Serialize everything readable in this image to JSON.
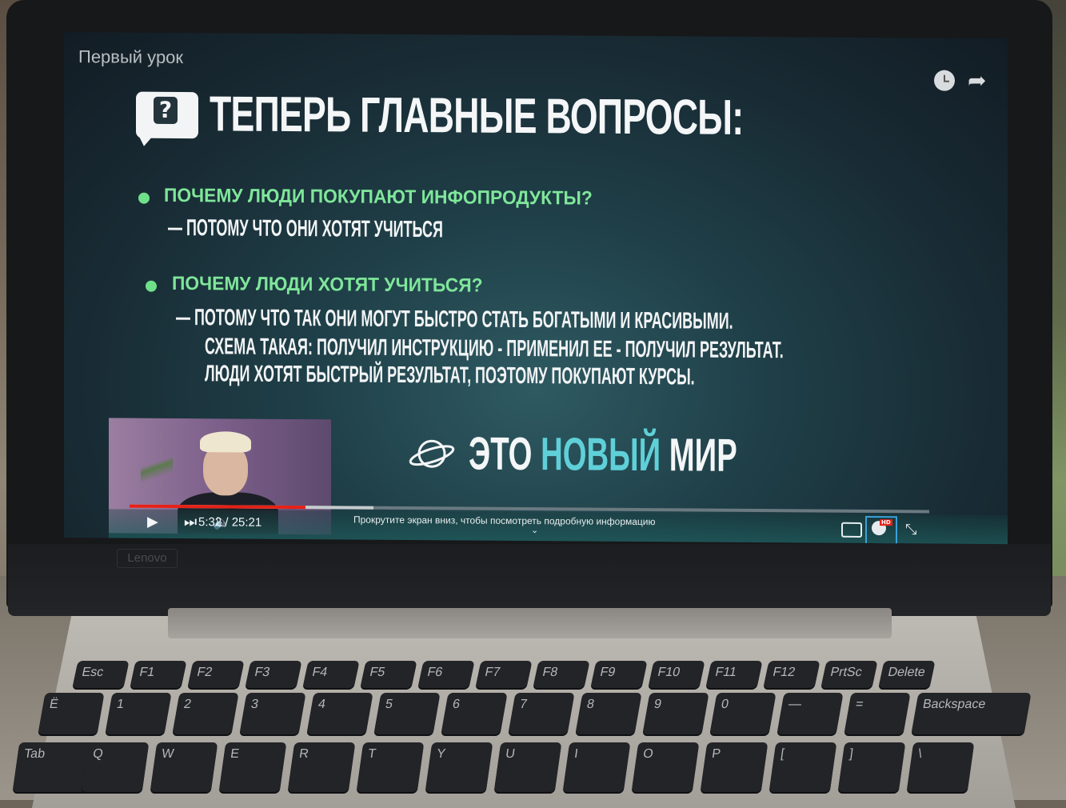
{
  "player": {
    "video_title": "Первый урок",
    "current_time": "5:32",
    "total_time": "25:21",
    "time_display": "5:32 / 25:21",
    "progress_fraction": 0.22,
    "buffer_fraction": 0.305,
    "scroll_hint": "Прокрутите экран вниз, чтобы посмотреть подробную информацию",
    "hd_badge": "HD",
    "icons": [
      "play-icon",
      "next-icon",
      "volume-icon",
      "captions-icon",
      "settings-icon",
      "exit-fullscreen-icon",
      "watch-later-icon",
      "share-icon"
    ]
  },
  "slide": {
    "title": "ТЕПЕРЬ ГЛАВНЫЕ ВОПРОСЫ:",
    "q1": "ПОЧЕМУ ЛЮДИ ПОКУПАЮТ ИНФОПРОДУКТЫ?",
    "a1": "— ПОТОМУ ЧТО ОНИ ХОТЯТ УЧИТЬСЯ",
    "q2": "ПОЧЕМУ ЛЮДИ ХОТЯТ УЧИТЬСЯ?",
    "a2_line1": "— ПОТОМУ ЧТО ТАК ОНИ МОГУТ БЫСТРО СТАТЬ БОГАТЫМИ И КРАСИВЫМИ.",
    "a2_line2": "СХЕМА ТАКАЯ: ПОЛУЧИЛ ИНСТРУКЦИЮ - ПРИМЕНИЛ ЕЕ - ПОЛУЧИЛ РЕЗУЛЬТАТ.",
    "a2_line3": "ЛЮДИ ХОТЯТ БЫСТРЫЙ РЕЗУЛЬТАТ, ПОЭТОМУ ПОКУПАЮТ КУРСЫ.",
    "tagline_part1": "ЭТО",
    "tagline_accent": "НОВЫЙ",
    "tagline_part2": "МИР",
    "accent_color": "#5fd0d8",
    "question_color": "#7fe69a"
  },
  "laptop": {
    "brand": "Lenovo"
  },
  "keyboard": {
    "fn_row": [
      "Esc",
      "F1",
      "F2",
      "F3",
      "F4",
      "F5",
      "F6",
      "F7",
      "F8",
      "F9",
      "F10",
      "F11",
      "F12",
      "PrtSc",
      "Delete"
    ],
    "num_row": [
      "Ё",
      "1",
      "2",
      "3",
      "4",
      "5",
      "6",
      "7",
      "8",
      "9",
      "0",
      "—",
      "=",
      "Backspace"
    ],
    "top_row": [
      "Tab",
      "Q",
      "W",
      "E",
      "R",
      "T",
      "Y",
      "U",
      "I",
      "O",
      "P",
      "[",
      "]",
      "\\"
    ]
  }
}
